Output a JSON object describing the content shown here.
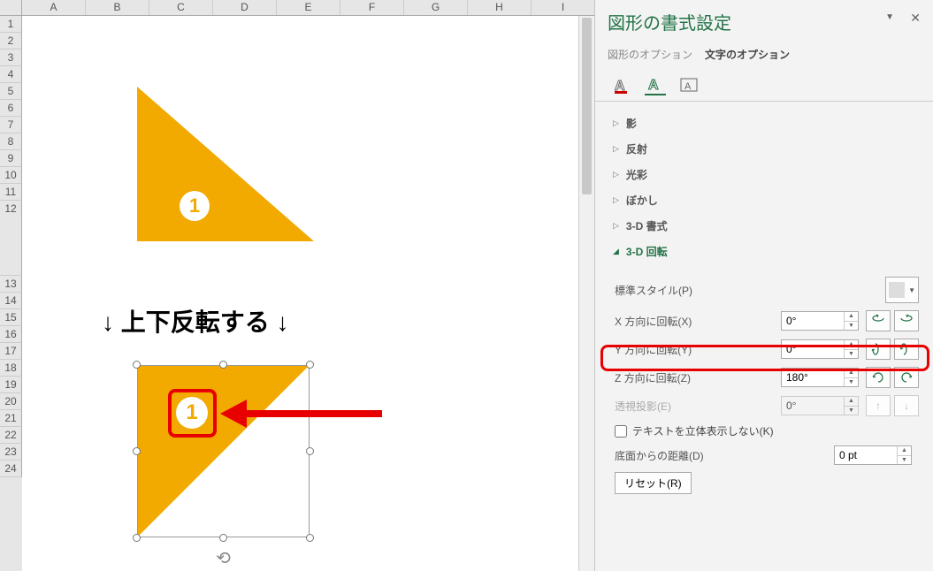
{
  "columns": [
    "",
    "A",
    "B",
    "C",
    "D",
    "E",
    "F",
    "G",
    "H",
    "I"
  ],
  "rows": [
    "1",
    "2",
    "3",
    "4",
    "5",
    "6",
    "7",
    "8",
    "9",
    "10",
    "11",
    "12",
    "13",
    "14",
    "15",
    "16",
    "17",
    "18",
    "19",
    "20",
    "21",
    "22",
    "23",
    "24"
  ],
  "shape_number": "1",
  "annotation_text": "↓ 上下反転する ↓",
  "panel": {
    "title": "図形の書式設定",
    "tabs": {
      "shape": "図形のオプション",
      "text": "文字のオプション"
    },
    "sections": {
      "shadow": "影",
      "reflection": "反射",
      "glow": "光彩",
      "soft": "ぼかし",
      "fmt3d": "3-D 書式",
      "rot3d": "3-D 回転"
    },
    "preset_label": "標準スタイル(P)",
    "x_label": "X 方向に回転(X)",
    "y_label": "Y 方向に回転(Y)",
    "z_label": "Z 方向に回転(Z)",
    "persp_label": "透視投影(E)",
    "x_val": "0°",
    "y_val": "0°",
    "z_val": "180°",
    "persp_val": "0°",
    "flat_text": "テキストを立体表示しない(K)",
    "distance_label": "底面からの距離(D)",
    "distance_val": "0 pt",
    "reset": "リセット(R)"
  }
}
